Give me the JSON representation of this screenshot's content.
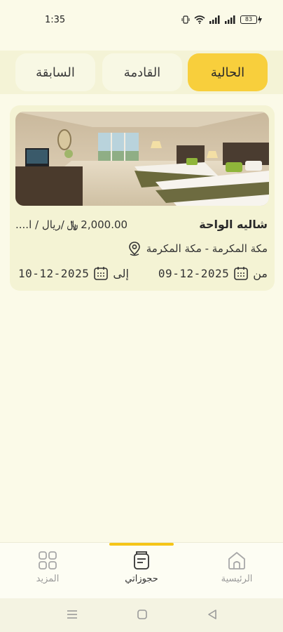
{
  "status_bar": {
    "time": "1:35",
    "battery_level": "83"
  },
  "tabs": [
    {
      "label": "الحالية",
      "active": true
    },
    {
      "label": "القادمة",
      "active": false
    },
    {
      "label": "السابقة",
      "active": false
    }
  ],
  "booking": {
    "name": "شاليه الواحة",
    "price": "2,000.00",
    "price_unit": "/ريال / ا....",
    "location": "مكة المكرمة - مكة المكرمة",
    "from_label": "من",
    "from_date": "09-12-2025",
    "to_label": "إلى",
    "to_date": "10-12-2025"
  },
  "bottom_nav": [
    {
      "label": "الرئيسية",
      "icon": "home-icon",
      "active": false
    },
    {
      "label": "حجوزاتي",
      "icon": "bookings-icon",
      "active": true
    },
    {
      "label": "المزيد",
      "icon": "grid-icon",
      "active": false
    }
  ],
  "colors": {
    "accent": "#f8cf3c",
    "background": "#fbfae8",
    "card": "#f4f3d4"
  }
}
